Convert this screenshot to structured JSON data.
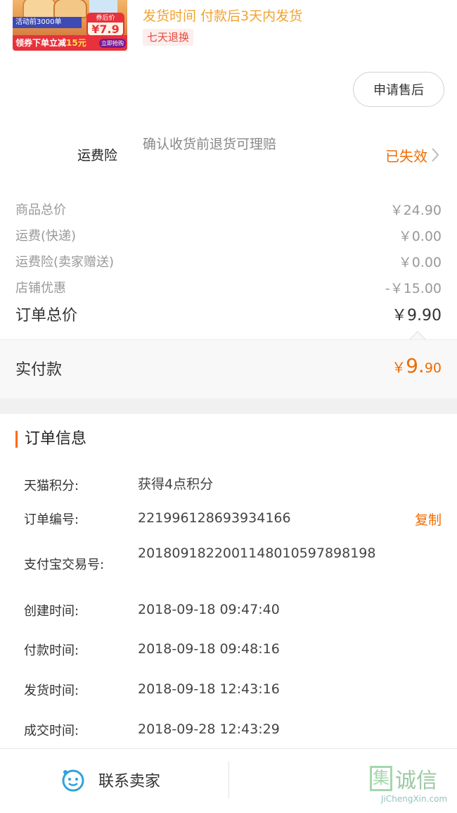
{
  "product": {
    "thumbnail": {
      "activity_text": "活动前3000单",
      "coupon_text": "领券下单立减",
      "coupon_amount": "15元",
      "price_label": "券后价",
      "price_value": "¥7.9",
      "buy_now": "立即抢购"
    },
    "ship_time": "发货时间  付款后3天内发货",
    "return_badge": "七天退换",
    "after_sale_button": "申请售后"
  },
  "freight_insurance": {
    "label": "运费险",
    "description": "确认收货前退货可理赔",
    "status": "已失效"
  },
  "summary": {
    "rows": [
      {
        "label": "商品总价",
        "value": "￥24.90"
      },
      {
        "label": "运费(快递)",
        "value": "￥0.00"
      },
      {
        "label": "运费险(卖家赠送)",
        "value": "￥0.00"
      },
      {
        "label": "店铺优惠",
        "value": "-￥15.00"
      }
    ],
    "total_label": "订单总价",
    "total_value": "￥9.90"
  },
  "paid": {
    "label": "实付款",
    "symbol": "￥",
    "integer": "9.",
    "decimal": "90"
  },
  "order_info": {
    "title": "订单信息",
    "rows": [
      {
        "label": "天猫积分:",
        "value": "获得4点积分"
      },
      {
        "label": "订单编号:",
        "value": "221996128693934166",
        "action": "复制"
      },
      {
        "label": "支付宝交易号:",
        "value": "2018091822001148010597898198"
      },
      {
        "label": "创建时间:",
        "value": "2018-09-18 09:47:40"
      },
      {
        "label": "付款时间:",
        "value": "2018-09-18 09:48:16"
      },
      {
        "label": "发货时间:",
        "value": "2018-09-18 12:43:16"
      },
      {
        "label": "成交时间:",
        "value": "2018-09-28 12:43:29"
      }
    ]
  },
  "bottom_bar": {
    "contact_label": "联系卖家",
    "watermark_text": "诚信",
    "watermark_mark": "集",
    "watermark_url": "JiChengXin.com"
  },
  "colors": {
    "accent": "#ef6c00",
    "ship_time": "#f0a330",
    "badge_text": "#e34a3d",
    "badge_bg": "#fdeeed",
    "muted": "#999999"
  }
}
